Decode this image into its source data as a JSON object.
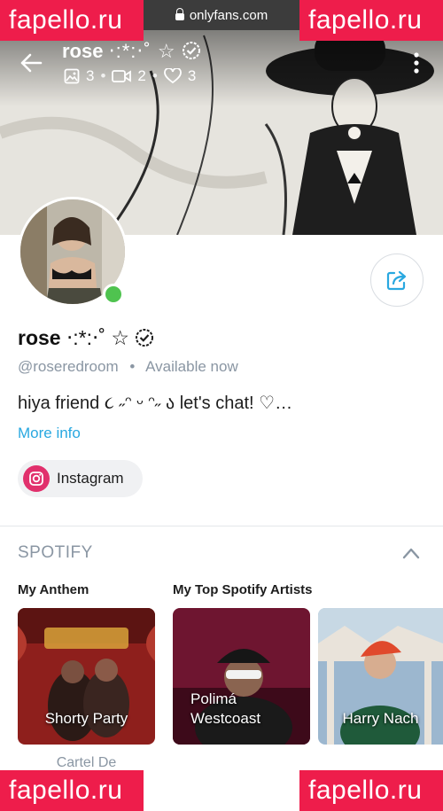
{
  "browser": {
    "url": "onlyfans.com"
  },
  "watermark": {
    "text": "fapello.ru"
  },
  "header": {
    "name": "rose",
    "name_deco": "‧:*:‧˚ ☆",
    "stats": {
      "photos": "3",
      "videos": "2",
      "likes": "3"
    }
  },
  "profile": {
    "name": "rose",
    "name_deco": "‧:*:‧˚ ☆",
    "handle": "@roseredroom",
    "separator": "•",
    "status": "Available now",
    "bio": "hiya friend ૮ ˶ᵔ ᵕ ᵔ˶ ა let's chat! ♡…",
    "more_info": "More info"
  },
  "social": {
    "instagram_label": "Instagram"
  },
  "spotify": {
    "title": "SPOTIFY",
    "anthem_label": "My Anthem",
    "artists_label": "My Top Spotify Artists",
    "anthem": {
      "title": "Shorty Party",
      "artist": "Cartel De"
    },
    "artists": [
      {
        "line1": "Polimá",
        "line2": "Westcoast"
      },
      {
        "name": "Harry Nach"
      }
    ]
  },
  "colors": {
    "accent": "#29a8e0",
    "online": "#4fc34f",
    "watermark": "#ee1d4b",
    "muted": "#8a96a3"
  }
}
